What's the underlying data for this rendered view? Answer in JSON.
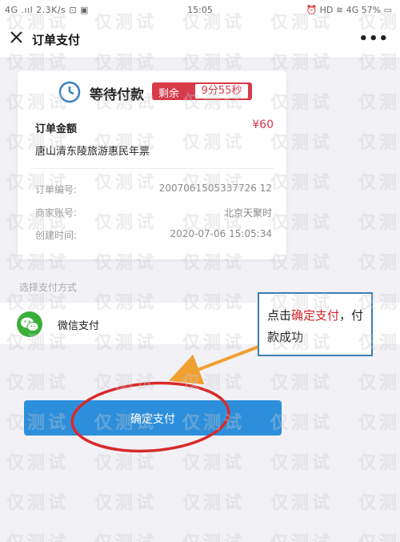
{
  "statusbar": {
    "left": "4G .ııl 2.3K/s ⊡ ▣",
    "time": "15:05",
    "right": "⏰ HD ≋ 4G 57% ▭"
  },
  "navbar": {
    "title": "订单支付"
  },
  "order": {
    "status": "等待付款",
    "countdown_label": "剩余",
    "countdown_time": "9分55秒",
    "amount_label": "订单金额",
    "amount_value": "¥60",
    "product": "唐山清东陵旅游惠民年票",
    "number_label": "订单编号:",
    "number_value": "2007061505337726 12",
    "merchant_label": "商家账号:",
    "merchant_value": "北京天聚时",
    "created_label": "创建时间:",
    "created_value": "2020-07-06 15:05:34"
  },
  "payment": {
    "section_label": "选择支付方式",
    "wechat_label": "微信支付",
    "confirm_label": "确定支付"
  },
  "callout": {
    "prefix": "点击",
    "highlight": "确定支付",
    "suffix": "，付款成功"
  },
  "watermark": "仅测试",
  "colors": {
    "accent_blue": "#2d8fdb",
    "countdown_red": "#d73a4a",
    "wechat_green": "#3aaf3a",
    "annotation_red": "#d0262c",
    "arrow_orange": "#f0a030"
  }
}
